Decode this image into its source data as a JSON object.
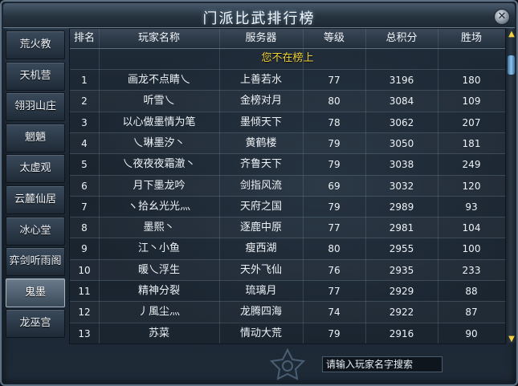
{
  "window": {
    "title": "门派比武排行榜",
    "close_symbol": "✕"
  },
  "sidebar": {
    "items": [
      {
        "label": "荒火教",
        "active": false
      },
      {
        "label": "天机营",
        "active": false
      },
      {
        "label": "翎羽山庄",
        "active": false
      },
      {
        "label": "魍魉",
        "active": false
      },
      {
        "label": "太虚观",
        "active": false
      },
      {
        "label": "云麓仙居",
        "active": false
      },
      {
        "label": "冰心堂",
        "active": false
      },
      {
        "label": "弈剑听雨阁",
        "active": false
      },
      {
        "label": "鬼墨",
        "active": true
      },
      {
        "label": "龙巫宫",
        "active": false
      }
    ]
  },
  "table": {
    "headers": [
      "排名",
      "玩家名称",
      "服务器",
      "等级",
      "总积分",
      "胜场"
    ],
    "notice": "您不在榜上",
    "rows": [
      [
        "1",
        "画龙不点睛乀",
        "上善若水",
        "77",
        "3196",
        "180"
      ],
      [
        "2",
        "听雪乀",
        "金榜对月",
        "80",
        "3084",
        "109"
      ],
      [
        "3",
        "以心做墨情为笔",
        "墨倾天下",
        "78",
        "3062",
        "207"
      ],
      [
        "4",
        "乀琳墨汐丶",
        "黄鹤楼",
        "79",
        "3050",
        "181"
      ],
      [
        "5",
        "乀夜夜夜霜澈丶",
        "齐鲁天下",
        "79",
        "3038",
        "249"
      ],
      [
        "6",
        "月下墨龙吟",
        "剑指风流",
        "69",
        "3032",
        "120"
      ],
      [
        "7",
        "ヽ拾幺光光灬",
        "天府之国",
        "79",
        "2989",
        "93"
      ],
      [
        "8",
        "墨熙丶",
        "逐鹿中原",
        "77",
        "2981",
        "104"
      ],
      [
        "9",
        "江丶小鱼",
        "瘦西湖",
        "80",
        "2955",
        "100"
      ],
      [
        "10",
        "暖乀浮生",
        "天外飞仙",
        "76",
        "2935",
        "233"
      ],
      [
        "11",
        "精神分裂",
        "琉璃月",
        "77",
        "2929",
        "88"
      ],
      [
        "12",
        "丿風尘灬",
        "龙腾四海",
        "74",
        "2922",
        "87"
      ],
      [
        "13",
        "苏菜",
        "情动大荒",
        "79",
        "2916",
        "90"
      ]
    ]
  },
  "scrollbar": {
    "up_symbol": "▲",
    "down_symbol": "▼",
    "position": 0.0
  },
  "search": {
    "placeholder": "请输入玩家名字搜索",
    "value": ""
  },
  "colors": {
    "notice": "#f1d23a",
    "accent": "#f4d13c",
    "active_tab": "#6a7a8a"
  }
}
